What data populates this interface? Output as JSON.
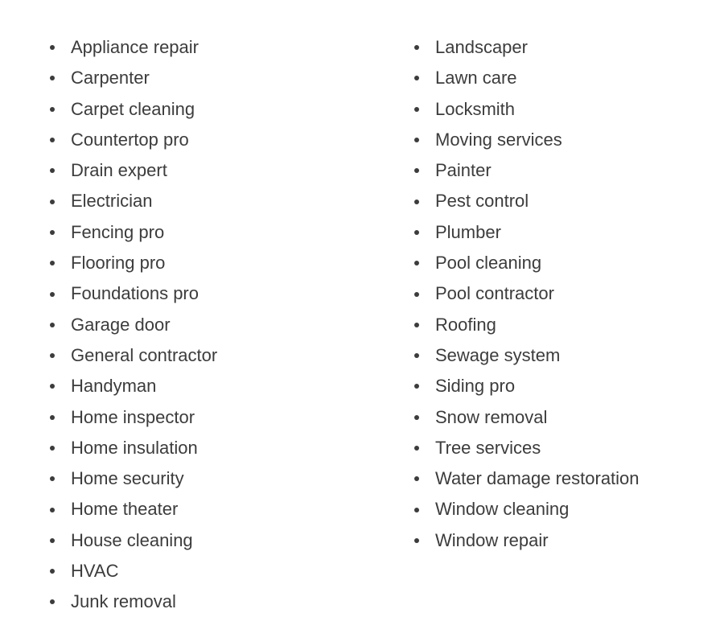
{
  "services": {
    "left_column": [
      "Appliance repair",
      "Carpenter",
      "Carpet cleaning",
      "Countertop pro",
      "Drain expert",
      "Electrician",
      "Fencing pro",
      "Flooring pro",
      "Foundations pro",
      "Garage door",
      "General contractor",
      "Handyman",
      "Home inspector",
      "Home insulation",
      "Home security",
      "Home theater",
      "House cleaning",
      "HVAC",
      "Junk removal"
    ],
    "right_column": [
      "Landscaper",
      "Lawn care",
      "Locksmith",
      "Moving services",
      "Painter",
      "Pest control",
      "Plumber",
      "Pool cleaning",
      "Pool contractor",
      "Roofing",
      "Sewage system",
      "Siding pro",
      "Snow removal",
      "Tree services",
      "Water damage restoration",
      "Window cleaning",
      "Window repair"
    ]
  }
}
